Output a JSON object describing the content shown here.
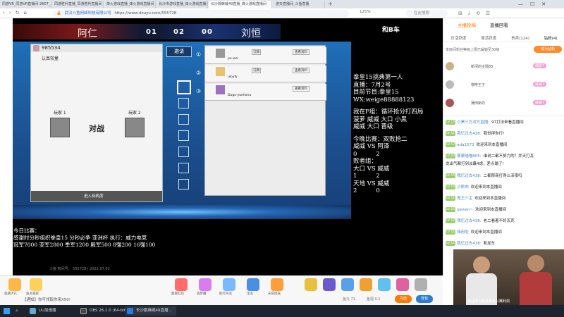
{
  "browser": {
    "tabs": [
      {
        "label": "同游VR_同游VR直播间-2607_斗鱼"
      },
      {
        "label": "同游胜利直播_同游胜利直播间"
      },
      {
        "label": "烽火游戏直播_烽火游戏直播间"
      },
      {
        "label": "长沙市游戏直播_烽火游戏直播间"
      },
      {
        "label": "长沙郡麻威49直播_烽火游戏直播间",
        "active": true
      },
      {
        "label": "游天直播间_斗鱼直播"
      }
    ],
    "site_badge": "武汉斗鱼网络科技有限公司",
    "url": "https://www.douyu.com/555728",
    "zoom": "125%",
    "search_placeholder": "在此搜索"
  },
  "video": {
    "left_player": "阿仁",
    "right_player": "刘恒",
    "scores": [
      "01",
      "02",
      "00"
    ],
    "corner_label": "和B车",
    "room_id": "985534",
    "hall_label": "认真较量",
    "invite_label": "邀请",
    "player1": "玩家 1",
    "player2": "玩家 2",
    "versus": "对战",
    "enter_label": "进入待机席",
    "slots": [
      {
        "num": "①",
        "name": "po-wei",
        "tag": "订牌",
        "btn": "查看资料"
      },
      {
        "num": "②",
        "name": "uloyfy",
        "tag": "订牌",
        "btn": "查看资料"
      },
      {
        "num": "③",
        "name": "Dugu-yunhonu",
        "tag": "",
        "btn": "查看资料"
      }
    ],
    "announce_lines": [
      "拳皇15挑典第一人",
      "直播：7月2号",
      "目前节目:拳皇15",
      "WX:weige88888123"
    ],
    "lineup_lines": [
      "我在F组：循环抢分打四局",
      "菠萝 威威 大口 小黑",
      "威威 大口 晋级"
    ],
    "tonight_lines": [
      "今晚比赛：双败抢二",
      "威威 VS 阿泽",
      "0          2",
      "败者组：",
      "大口 VS 威威",
      "1          2",
      "天地 VS 威威",
      "2          0"
    ],
    "today_lines": [
      "今日比赛：",
      "感谢时分秒组织拳皇15 分秒必争 亚洲杯 执行：威力电竞",
      "冠军7000 亚军2800 季军1200 殿军500 8强200 16强100"
    ],
    "footer": "斗鱼 房间号： 555728 | 2022.07.02"
  },
  "sidebar": {
    "tab_main": "主播投稿",
    "tab_rank": "直播回看",
    "rank_tabs": [
      "日活跃度",
      "周活跃度",
      "贵宾(124)",
      "钻粉(4)"
    ],
    "notice": "本房间粉丝等级上限已解锁至30级",
    "become_fan": "成为钻粉",
    "fans": [
      {
        "name": "新闲的主题83",
        "badge": "威胁7"
      },
      {
        "name": "咖啡王子",
        "badge": "威威7"
      },
      {
        "name": "蒲田新的",
        "badge": "威威7"
      }
    ],
    "chat": [
      {
        "lv": "LV 15",
        "who": "小黑三方对方直播:",
        "msg": "97打法来看直播间"
      },
      {
        "lv": "LV 11",
        "who": "我忆过去438:",
        "msg": "我觉得你行!"
      },
      {
        "lv": "LV 17",
        "who": "ada1573",
        "msg": "欢迎来到本直播间"
      },
      {
        "lv": "LV 20",
        "who": "蔡蔡喵喵805:",
        "msg": "谁说二都不努力的？并天打瓦"
      },
      {
        "lv": "",
        "who": "",
        "msg": "龙出气都打到淡囊4虑，差点输了!"
      },
      {
        "lv": "LV 15",
        "who": "我忆过去438:",
        "msg": "二都那商打得么深夜吗"
      },
      {
        "lv": "LV 14",
        "who": "小黔肉",
        "msg": "欢迎来到本直播间"
      },
      {
        "lv": "LV 11",
        "who": "鬼王少主",
        "msg": "欢迎来到本直播间"
      },
      {
        "lv": "LV 15",
        "who": "gewen~",
        "msg": "欢迎来到本直播间"
      },
      {
        "lv": "LV 12",
        "who": "我忆过去438:",
        "msg": "老二看着不好瓦克"
      },
      {
        "lv": "LV 11",
        "who": "烽用啦",
        "msg": "欢迎来到本直播间"
      },
      {
        "lv": "LV 11",
        "who": "我忆过去438:",
        "msg": "和加车"
      }
    ]
  },
  "gifts": {
    "items": [
      "鱼跳大礼",
      "鱼丸福袋",
      "超管红包",
      "森梦魔",
      "航行鸟龙",
      "宝龙",
      "天空搭盖"
    ],
    "notice": "【通知】你可领取你来X50!",
    "fish_balls": "鱼丸 71",
    "coins": "鱼翅 0.1",
    "recharge": "充值",
    "backpack": "背包"
  },
  "taskbar": {
    "items": [
      "UU加速器",
      "OBS 26.1.0 (64-bit...",
      "长沙郡麻威49直播..."
    ],
    "caption": "孤注浪与屡屡被杀斗鹰利剑"
  },
  "colors": {
    "accent": "#ff7a00",
    "blue_bg": "#1f6fb8"
  }
}
